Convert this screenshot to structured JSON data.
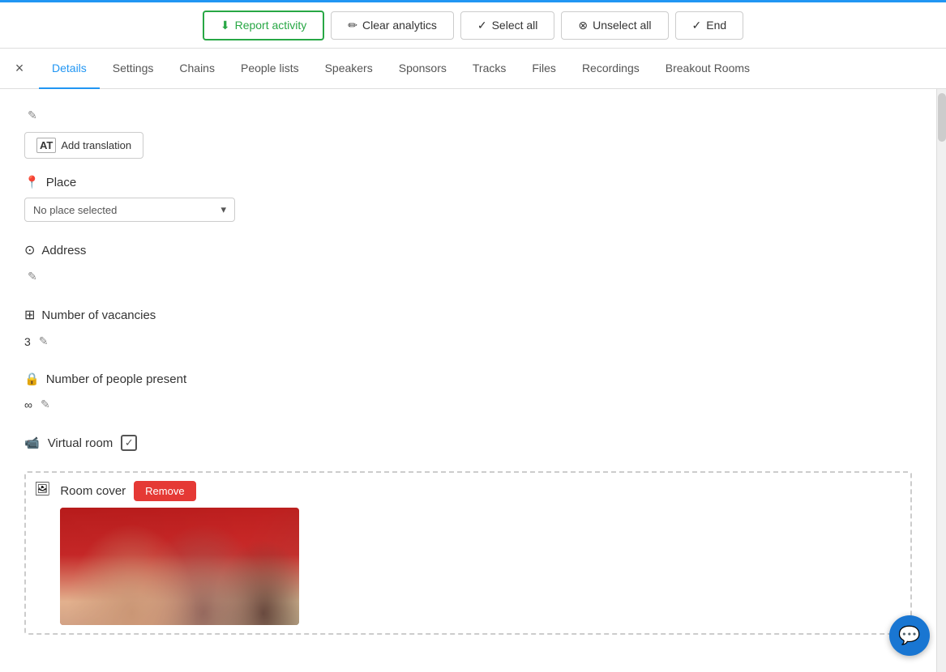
{
  "toolbar": {
    "report_activity_label": "Report activity",
    "clear_analytics_label": "Clear analytics",
    "select_all_label": "Select all",
    "unselect_all_label": "Unselect all",
    "end_label": "End"
  },
  "tabs": {
    "close_label": "×",
    "items": [
      {
        "id": "details",
        "label": "Details",
        "active": true
      },
      {
        "id": "settings",
        "label": "Settings",
        "active": false
      },
      {
        "id": "chains",
        "label": "Chains",
        "active": false
      },
      {
        "id": "people-lists",
        "label": "People lists",
        "active": false
      },
      {
        "id": "speakers",
        "label": "Speakers",
        "active": false
      },
      {
        "id": "sponsors",
        "label": "Sponsors",
        "active": false
      },
      {
        "id": "tracks",
        "label": "Tracks",
        "active": false
      },
      {
        "id": "files",
        "label": "Files",
        "active": false
      },
      {
        "id": "recordings",
        "label": "Recordings",
        "active": false
      },
      {
        "id": "breakout-rooms",
        "label": "Breakout Rooms",
        "active": false
      }
    ]
  },
  "content": {
    "add_translation_label": "Add translation",
    "place_section": {
      "label": "Place",
      "placeholder": "No place selected"
    },
    "address_section": {
      "label": "Address"
    },
    "vacancies_section": {
      "label": "Number of vacancies",
      "value": "3"
    },
    "people_present_section": {
      "label": "Number of people present",
      "value": "∞"
    },
    "virtual_room_section": {
      "label": "Virtual room",
      "checked": true
    },
    "room_cover_section": {
      "label": "Room cover",
      "remove_label": "Remove"
    }
  },
  "chat_btn": {
    "label": "💬"
  },
  "icons": {
    "download": "⬇",
    "brush": "✏",
    "check_circle": "✓",
    "close_circle": "⊗",
    "check": "✓",
    "pin": "📍",
    "compass": "🧭",
    "grid": "⊞",
    "lock": "🔒",
    "video": "📹",
    "image": "🖼",
    "translate": "AT",
    "edit": "✎",
    "chevron_down": "▾"
  }
}
